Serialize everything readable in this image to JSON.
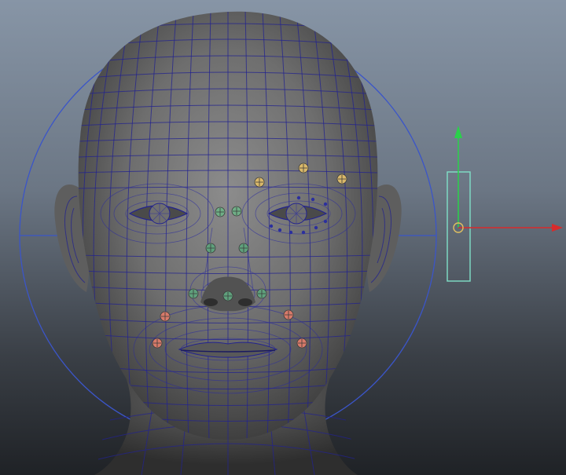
{
  "viewport": {
    "background_top": "#8795a6",
    "background_bottom": "#1f2226",
    "mesh_color": "#23238f",
    "guide_color": "#3b55c8"
  },
  "icons": {
    "face_mesh": "head-mesh-icon",
    "locator": "locator-icon",
    "manipulator": "move-manipulator-icon"
  },
  "locators": {
    "colors": {
      "brow": "#d9b86a",
      "eye": "#6fae86",
      "cheek": "#5fa07c",
      "mouth": "#d77a6a",
      "lid": "#2b2f9e"
    },
    "points": [
      {
        "group": "brow",
        "side": "left"
      },
      {
        "group": "brow",
        "side": "right-inner"
      },
      {
        "group": "brow",
        "side": "right-outer"
      },
      {
        "group": "eye",
        "side": "left-inner"
      },
      {
        "group": "eye",
        "side": "right-inner"
      },
      {
        "group": "cheek",
        "side": "left"
      },
      {
        "group": "cheek",
        "side": "right"
      },
      {
        "group": "cheek",
        "side": "left-nose"
      },
      {
        "group": "cheek",
        "side": "center-nose"
      },
      {
        "group": "cheek",
        "side": "right-nose"
      },
      {
        "group": "mouth",
        "side": "left-upper"
      },
      {
        "group": "mouth",
        "side": "right-upper"
      },
      {
        "group": "mouth",
        "side": "left-lower"
      },
      {
        "group": "mouth",
        "side": "right-lower"
      }
    ]
  },
  "manipulator": {
    "y_axis_color": "#2ad14a",
    "x_axis_color": "#d82b2b",
    "handle_color": "#7fe0c8",
    "pivot_color": "#e0c060"
  }
}
